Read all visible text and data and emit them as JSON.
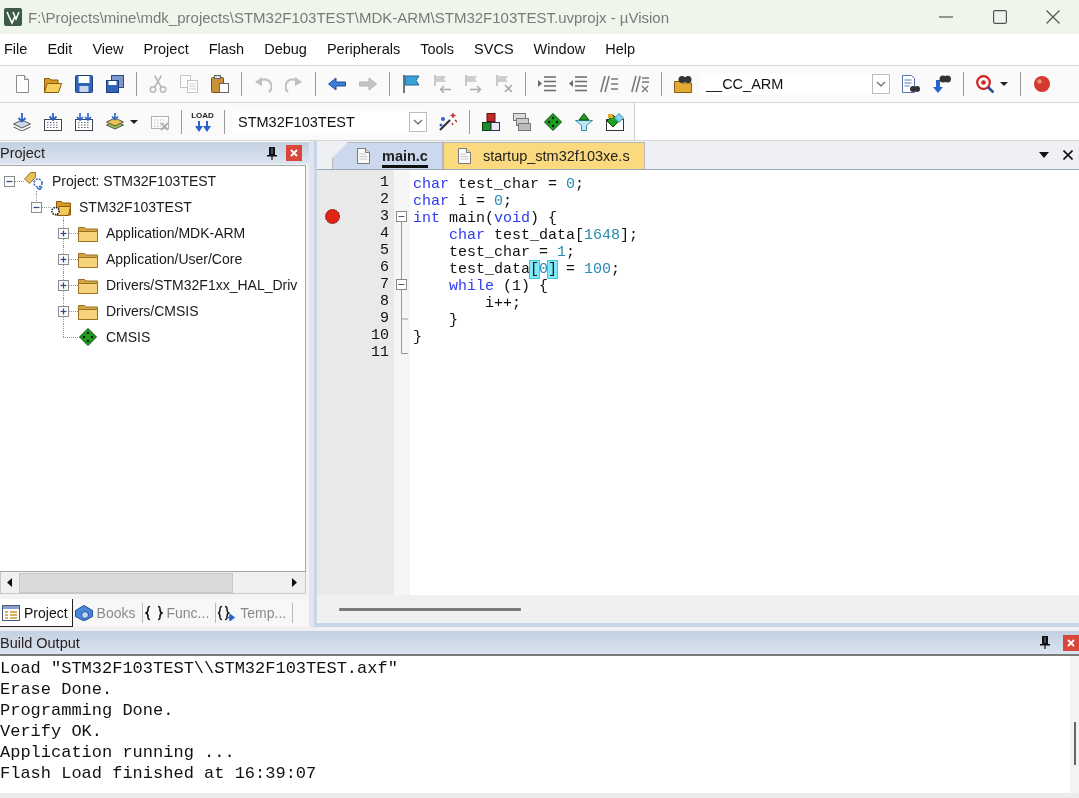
{
  "window": {
    "title": "F:\\Projects\\mine\\mdk_projects\\STM32F103TEST\\MDK-ARM\\STM32F103TEST.uvprojx - µVision"
  },
  "menu": [
    "File",
    "Edit",
    "View",
    "Project",
    "Flash",
    "Debug",
    "Peripherals",
    "Tools",
    "SVCS",
    "Window",
    "Help"
  ],
  "toolbar_1": [
    {
      "kind": "new-file",
      "disabled": false
    },
    {
      "kind": "open",
      "disabled": false
    },
    {
      "kind": "save",
      "disabled": false
    },
    {
      "kind": "save-all",
      "disabled": false
    },
    {
      "kind": "separator"
    },
    {
      "kind": "cut",
      "disabled": true
    },
    {
      "kind": "copy",
      "disabled": true
    },
    {
      "kind": "paste",
      "disabled": false
    },
    {
      "kind": "separator"
    },
    {
      "kind": "undo",
      "disabled": true
    },
    {
      "kind": "redo",
      "disabled": true
    },
    {
      "kind": "separator"
    },
    {
      "kind": "back",
      "disabled": false
    },
    {
      "kind": "forward",
      "disabled": true
    },
    {
      "kind": "separator"
    },
    {
      "kind": "bookmark",
      "disabled": false
    },
    {
      "kind": "bookmark-prev",
      "disabled": true
    },
    {
      "kind": "bookmark-next",
      "disabled": true
    },
    {
      "kind": "bookmark-clear",
      "disabled": true
    },
    {
      "kind": "separator"
    },
    {
      "kind": "indent",
      "disabled": false
    },
    {
      "kind": "unindent",
      "disabled": false
    },
    {
      "kind": "comment",
      "disabled": false
    },
    {
      "kind": "uncomment",
      "disabled": false
    },
    {
      "kind": "separator"
    },
    {
      "kind": "find-in-files",
      "disabled": false
    },
    {
      "kind": "combo",
      "value": "__CC_ARM"
    },
    {
      "kind": "find",
      "disabled": false
    },
    {
      "kind": "incremental-find",
      "disabled": false
    },
    {
      "kind": "separator"
    },
    {
      "kind": "debug",
      "disabled": false,
      "dropdown": true
    },
    {
      "kind": "separator"
    },
    {
      "kind": "breakpoint",
      "disabled": false
    }
  ],
  "toolbar_2": [
    {
      "kind": "translate",
      "disabled": false
    },
    {
      "kind": "build",
      "disabled": false
    },
    {
      "kind": "rebuild",
      "disabled": false
    },
    {
      "kind": "batch-build",
      "disabled": false,
      "dropdown": true
    },
    {
      "kind": "stop-build",
      "disabled": true
    },
    {
      "kind": "separator"
    },
    {
      "kind": "load",
      "label": "LOAD",
      "disabled": false
    },
    {
      "kind": "separator"
    },
    {
      "kind": "combo",
      "value": "STM32F103TEST"
    },
    {
      "kind": "target-options",
      "disabled": false
    },
    {
      "kind": "separator"
    },
    {
      "kind": "manage-project",
      "disabled": false
    },
    {
      "kind": "manage-multi",
      "disabled": false
    },
    {
      "kind": "manage-rte",
      "disabled": false
    },
    {
      "kind": "pack-installer",
      "disabled": false
    },
    {
      "kind": "select-packs",
      "disabled": false
    }
  ],
  "project_panel": {
    "title": "Project",
    "tree": [
      {
        "kind": "project",
        "label": "Project: STM32F103TEST",
        "expanded": true,
        "children": [
          {
            "kind": "target",
            "label": "STM32F103TEST",
            "expanded": true,
            "children": [
              {
                "kind": "folder",
                "label": "Application/MDK-ARM",
                "expanded": false
              },
              {
                "kind": "folder",
                "label": "Application/User/Core",
                "expanded": false
              },
              {
                "kind": "folder",
                "label": "Drivers/STM32F1xx_HAL_Driv",
                "expanded": false
              },
              {
                "kind": "folder",
                "label": "Drivers/CMSIS",
                "expanded": false
              },
              {
                "kind": "component",
                "label": "CMSIS"
              }
            ]
          }
        ]
      }
    ],
    "tabs": [
      {
        "label": "Project",
        "kind": "project",
        "selected": true
      },
      {
        "label": "Books",
        "kind": "books",
        "selected": false
      },
      {
        "label": "Func...",
        "kind": "functions",
        "selected": false
      },
      {
        "label": "Temp...",
        "kind": "templates",
        "selected": false
      }
    ]
  },
  "editor": {
    "tabs": [
      {
        "label": "main.c",
        "selected": true
      },
      {
        "label": "startup_stm32f103xe.s",
        "selected": false
      }
    ],
    "lines": [
      {
        "number": "1",
        "kind": "plain",
        "breakpoint": false,
        "tokens": [
          {
            "kind": "keyword",
            "text": "char"
          },
          {
            "kind": "plain",
            "text": " test_char = "
          },
          {
            "kind": "number",
            "text": "0"
          },
          {
            "kind": "plain",
            "text": ";"
          }
        ]
      },
      {
        "number": "2",
        "kind": "plain",
        "breakpoint": false,
        "tokens": [
          {
            "kind": "keyword",
            "text": "char"
          },
          {
            "kind": "plain",
            "text": " i = "
          },
          {
            "kind": "number",
            "text": "0"
          },
          {
            "kind": "plain",
            "text": ";"
          }
        ]
      },
      {
        "number": "3",
        "kind": "fold-start",
        "breakpoint": true,
        "tokens": [
          {
            "kind": "keyword",
            "text": "int"
          },
          {
            "kind": "plain",
            "text": " main("
          },
          {
            "kind": "keyword",
            "text": "void"
          },
          {
            "kind": "plain",
            "text": ") {"
          }
        ]
      },
      {
        "number": "4",
        "kind": "fold-line",
        "breakpoint": false,
        "tokens": [
          {
            "kind": "keyword",
            "text": "    char"
          },
          {
            "kind": "plain",
            "text": " test_data["
          },
          {
            "kind": "number",
            "text": "1648"
          },
          {
            "kind": "plain",
            "text": "];"
          }
        ]
      },
      {
        "number": "5",
        "kind": "fold-line",
        "breakpoint": false,
        "tokens": [
          {
            "kind": "plain",
            "text": "    test_char = "
          },
          {
            "kind": "number",
            "text": "1"
          },
          {
            "kind": "plain",
            "text": ";"
          }
        ]
      },
      {
        "number": "6",
        "kind": "fold-line",
        "breakpoint": false,
        "tokens": [
          {
            "kind": "plain",
            "text": "    test_data"
          },
          {
            "kind": "bracket-match",
            "text": "["
          },
          {
            "kind": "number",
            "text": "0"
          },
          {
            "kind": "bracket-match",
            "text": "]"
          },
          {
            "kind": "plain",
            "text": " = "
          },
          {
            "kind": "number",
            "text": "100"
          },
          {
            "kind": "plain",
            "text": ";"
          }
        ]
      },
      {
        "number": "7",
        "kind": "fold-nested-start",
        "breakpoint": false,
        "tokens": [
          {
            "kind": "keyword",
            "text": "    while"
          },
          {
            "kind": "plain",
            "text": " (1) {"
          }
        ]
      },
      {
        "number": "8",
        "kind": "fold-line",
        "breakpoint": false,
        "tokens": [
          {
            "kind": "plain",
            "text": "        i++;"
          }
        ]
      },
      {
        "number": "9",
        "kind": "fold-tick",
        "breakpoint": false,
        "tokens": [
          {
            "kind": "plain",
            "text": "    }"
          }
        ]
      },
      {
        "number": "10",
        "kind": "fold-line",
        "breakpoint": false,
        "tokens": [
          {
            "kind": "plain",
            "text": "}"
          }
        ]
      },
      {
        "number": "11",
        "kind": "fold-end",
        "breakpoint": false
      }
    ]
  },
  "build_output": {
    "title": "Build Output",
    "lines": [
      "Load \"STM32F103TEST\\\\STM32F103TEST.axf\"",
      "Erase Done.",
      "Programming Done.",
      "Verify OK.",
      "Application running ...",
      "Flash Load finished at 16:39:07"
    ]
  }
}
